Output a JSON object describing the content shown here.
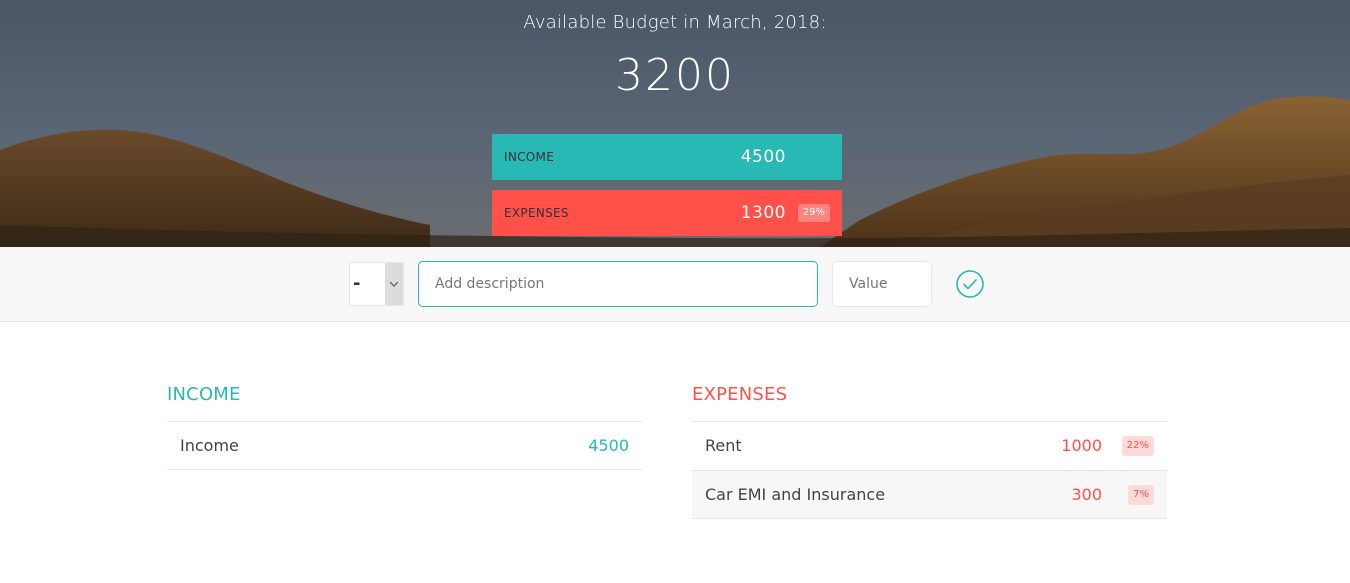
{
  "header": {
    "title": "Available Budget in March, 2018:",
    "budget": "3200"
  },
  "summary": {
    "income_label": "Income",
    "income_value": "4500",
    "expenses_label": "Expenses",
    "expenses_value": "1300",
    "expenses_percentage": "29%"
  },
  "add_form": {
    "type_value": "-",
    "description_placeholder": "Add description",
    "value_placeholder": "Value",
    "submit_icon": "check-circle-icon"
  },
  "income": {
    "title": "Income",
    "items": [
      {
        "description": "Income",
        "value": "4500"
      }
    ]
  },
  "expenses": {
    "title": "Expenses",
    "items": [
      {
        "description": "Rent",
        "value": "1000",
        "percentage": "22%"
      },
      {
        "description": "Car EMI and Insurance",
        "value": "300",
        "percentage": "7%"
      }
    ]
  },
  "colors": {
    "income_accent": "#28b9b5",
    "expenses_accent": "#ff5049"
  }
}
